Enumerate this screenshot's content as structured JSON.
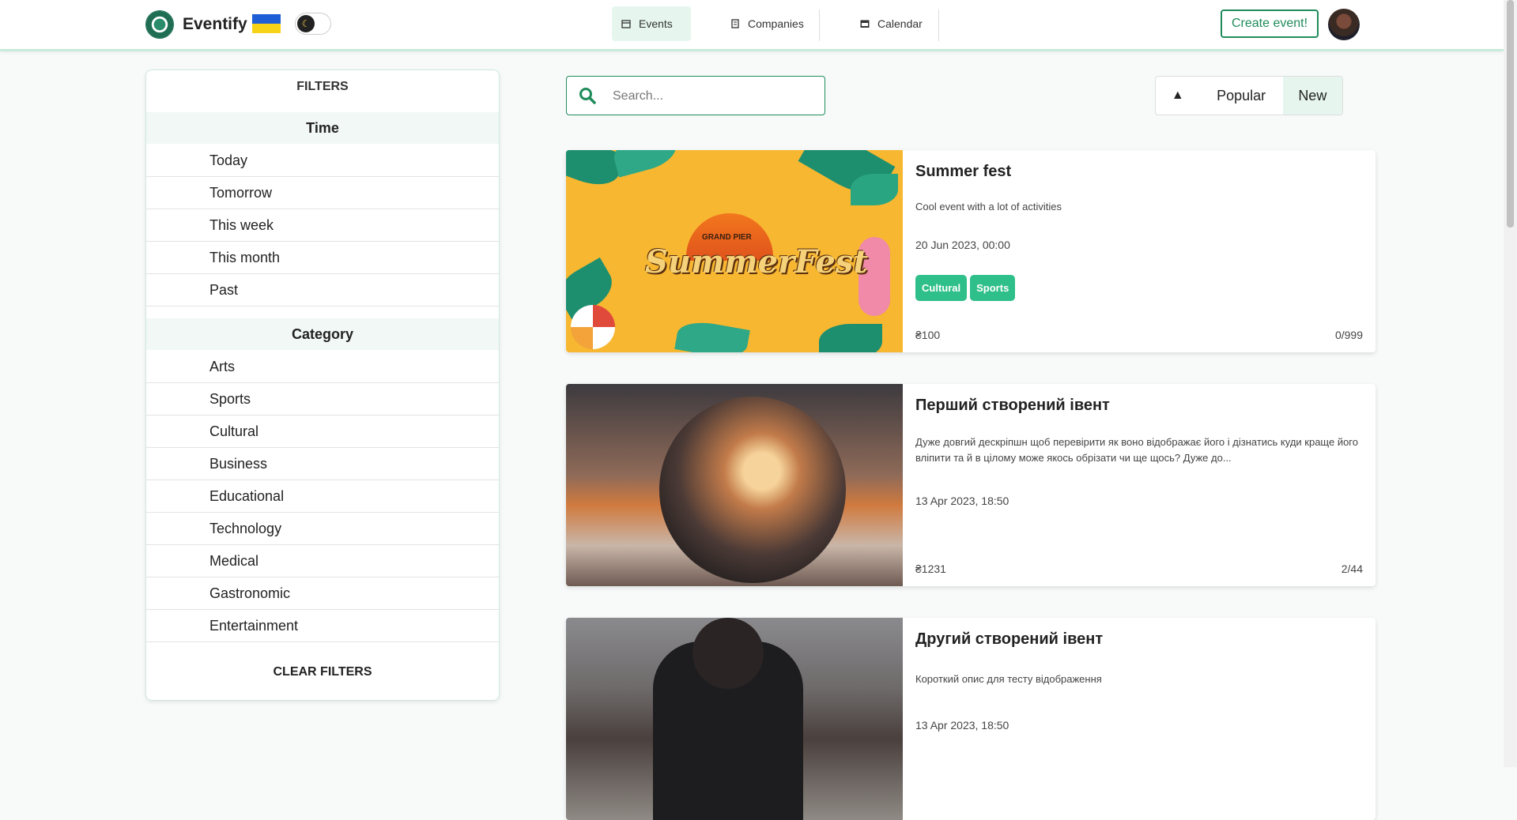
{
  "header": {
    "brand": "Eventify",
    "nav": [
      {
        "label": "Events",
        "icon": "calendar-small-icon",
        "active": true
      },
      {
        "label": "Companies",
        "icon": "building-icon",
        "active": false
      },
      {
        "label": "Calendar",
        "icon": "calendar-icon",
        "active": false
      }
    ],
    "create_label": "Create event!"
  },
  "filters": {
    "title": "FILTERS",
    "time_heading": "Time",
    "time_items": [
      "Today",
      "Tomorrow",
      "This week",
      "This month",
      "Past"
    ],
    "category_heading": "Category",
    "category_items": [
      "Arts",
      "Sports",
      "Cultural",
      "Business",
      "Educational",
      "Technology",
      "Medical",
      "Gastronomic",
      "Entertainment"
    ],
    "clear_label": "CLEAR FILTERS"
  },
  "search": {
    "placeholder": "Search...",
    "value": ""
  },
  "sort": {
    "arrow": "▲",
    "options": [
      "Popular",
      "New"
    ],
    "selected": "New"
  },
  "events": [
    {
      "title": "Summer fest",
      "description": "Cool event with a lot of activities",
      "date": "20 Jun 2023, 00:00",
      "tags": [
        "Cultural",
        "Sports"
      ],
      "price": "₴100",
      "seats": "0/999",
      "image_text": [
        "GRAND PIER",
        "SummerFest"
      ]
    },
    {
      "title": "Перший створений івент",
      "description": "Дуже довгий дескріпшн щоб перевірити як воно відображає його і дізнатись куди краще його вліпити та й в цілому може якось обрізати чи ще щось? Дуже до...",
      "date": "13 Apr 2023, 18:50",
      "tags": [],
      "price": "₴1231",
      "seats": "2/44"
    },
    {
      "title": "Другий створений івент",
      "description": "Короткий опис для тесту відображення",
      "date": "13 Apr 2023, 18:50",
      "tags": []
    }
  ],
  "colors": {
    "accent": "#1f8c5a",
    "tag": "#2fbf8a",
    "active_bg": "#e6f6ef"
  }
}
